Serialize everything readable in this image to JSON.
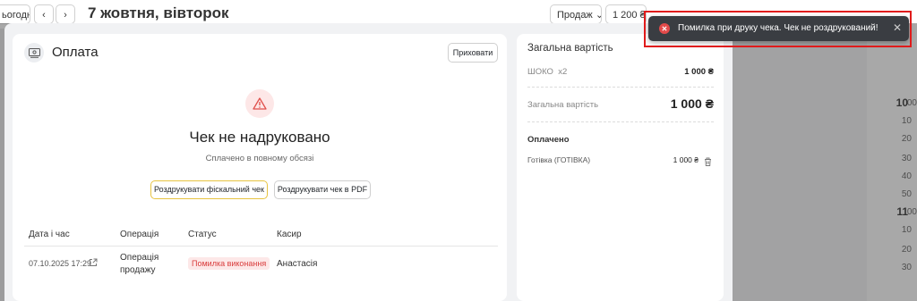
{
  "header": {
    "today_label": "ьогодні",
    "prev": "‹",
    "next": "›",
    "date_title": "7 жовтня, вівторок",
    "sales_select": "Продаж",
    "amount_label": "1 200 ₴"
  },
  "timeline": {
    "rows": [
      "10",
      "00",
      "10",
      "20",
      "30",
      "40",
      "50",
      "11",
      "00",
      "10",
      "20",
      "30"
    ]
  },
  "payment": {
    "title": "Оплата",
    "hide_label": "Приховати",
    "status_title": "Чек не надруковано",
    "status_sub": "Сплачено в повному обсязі",
    "print_fiscal": "Роздрукувати фіскальний чек",
    "print_pdf": "Роздрукувати чек в PDF",
    "table": {
      "headers": [
        "Дата і час",
        "Операція",
        "Статус",
        "Касир"
      ],
      "row": {
        "datetime": "07.10.2025 17:29",
        "operation_line1": "Операція",
        "operation_line2": "продажу",
        "status": "Помилка виконання",
        "cashier": "Анастасія"
      }
    }
  },
  "summary": {
    "title": "Загальна вартість",
    "item_name": "ШОКО",
    "item_qty": "x2",
    "item_price": "1 000 ₴",
    "total_label": "Загальна вартість",
    "total_value": "1 000 ₴",
    "paid_title": "Оплачено",
    "paid_method": "Готівка (ГОТІВКА)",
    "paid_value": "1 000 ₴"
  },
  "toast": {
    "message": "Помилка при друку чека. Чек не роздрукований!",
    "close": "✕"
  }
}
